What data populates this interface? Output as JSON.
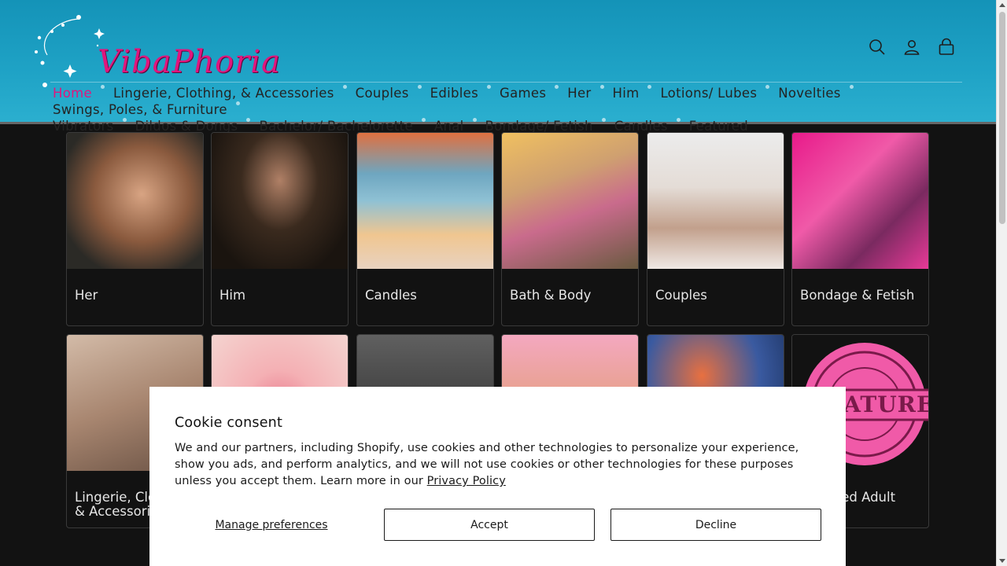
{
  "brand": {
    "logo_text": "VibaPhoria",
    "accent": "#e0167d"
  },
  "header": {
    "icons": [
      "search-icon",
      "account-icon",
      "cart-icon"
    ]
  },
  "nav": {
    "items": [
      {
        "label": "Home",
        "active": true
      },
      {
        "label": "Lingerie, Clothing, & Accessories"
      },
      {
        "label": "Couples"
      },
      {
        "label": "Edibles"
      },
      {
        "label": "Games"
      },
      {
        "label": "Her"
      },
      {
        "label": "Him"
      },
      {
        "label": "Lotions/ Lubes"
      },
      {
        "label": "Novelties"
      },
      {
        "label": "Swings, Poles, & Furniture"
      },
      {
        "label": "Vibrators"
      },
      {
        "label": "Dildos & Dongs"
      },
      {
        "label": "Bachelor/ Bachelorette"
      },
      {
        "label": "Anal"
      },
      {
        "label": "Bondage/ Fetish"
      },
      {
        "label": "Candles"
      },
      {
        "label": "Featured"
      }
    ]
  },
  "collections": {
    "row1": [
      {
        "title": "Her"
      },
      {
        "title": "Him"
      },
      {
        "title": "Candles"
      },
      {
        "title": "Bath & Body"
      },
      {
        "title": "Couples"
      },
      {
        "title": "Bondage & Fetish"
      }
    ],
    "row2": [
      {
        "title": "Lingerie, Clothing, & Accessories"
      },
      {
        "title": ""
      },
      {
        "title": ""
      },
      {
        "title": ""
      },
      {
        "title": ""
      },
      {
        "title": "Featured Adult Toys"
      }
    ],
    "featured_stamp_text": "FEATURED"
  },
  "cookie": {
    "title": "Cookie consent",
    "body": "We and our partners, including Shopify, use cookies and other technologies to personalize your experience, show you ads, and perform analytics, and we will not use cookies or other technologies for these purposes unless you accept them. Learn more in our ",
    "link": "Privacy Policy",
    "manage": "Manage preferences",
    "accept": "Accept",
    "decline": "Decline"
  }
}
